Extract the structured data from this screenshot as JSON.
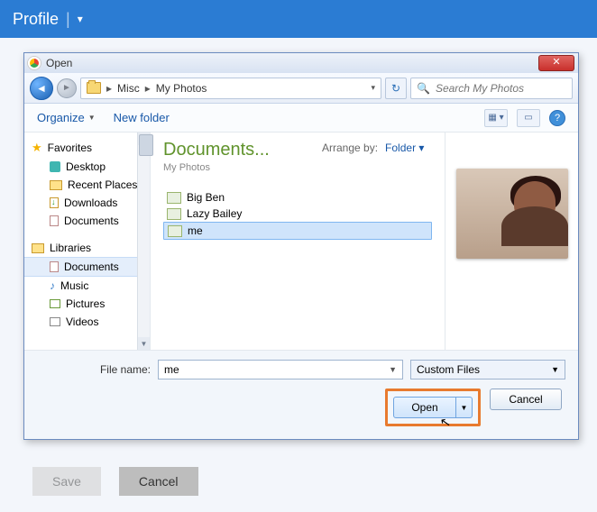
{
  "profile": {
    "label": "Profile"
  },
  "dialog": {
    "title": "Open",
    "breadcrumb": {
      "parts": [
        "Misc",
        "My Photos"
      ]
    },
    "search_placeholder": "Search My Photos",
    "toolbar": {
      "organize": "Organize",
      "new_folder": "New folder"
    },
    "sidebar": {
      "favorites": {
        "label": "Favorites",
        "items": [
          "Desktop",
          "Recent Places",
          "Downloads",
          "Documents"
        ]
      },
      "libraries": {
        "label": "Libraries",
        "items": [
          "Documents",
          "Music",
          "Pictures",
          "Videos"
        ],
        "selected": "Documents"
      }
    },
    "main": {
      "library_title": "Documents...",
      "library_sub": "My Photos",
      "arrange_label": "Arrange by:",
      "arrange_value": "Folder",
      "files": [
        "Big Ben",
        "Lazy Bailey",
        "me"
      ],
      "selected_file": "me"
    },
    "filename_label": "File name:",
    "filename_value": "me",
    "filter_value": "Custom Files",
    "open_label": "Open",
    "cancel_label": "Cancel"
  },
  "page_buttons": {
    "save": "Save",
    "cancel": "Cancel"
  }
}
